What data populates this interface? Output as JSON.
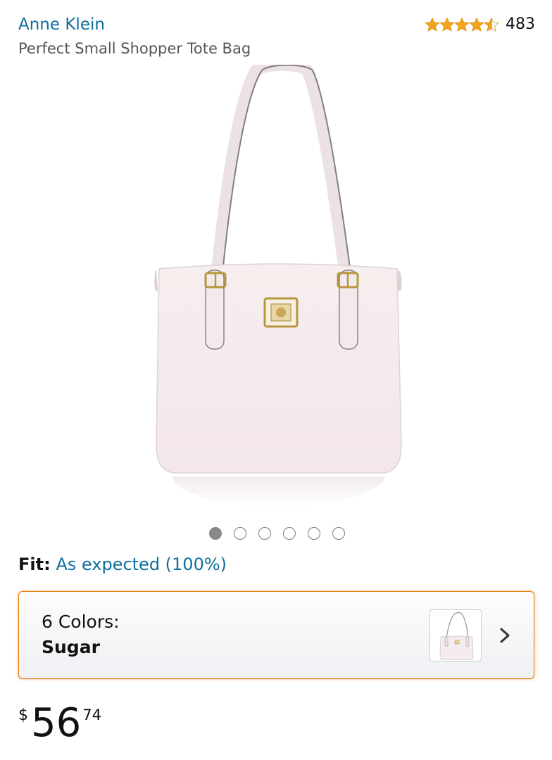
{
  "product": {
    "brand": "Anne Klein",
    "title": "Perfect Small Shopper Tote Bag"
  },
  "rating": {
    "stars": 4.5,
    "count": "483",
    "star_color": "#F4A41C"
  },
  "gallery": {
    "image_icon": "white-tote-bag-photo",
    "image_count": 6,
    "active_index": 0
  },
  "fit": {
    "label": "Fit:",
    "value": "As expected (100%)"
  },
  "variant": {
    "colors_label": "6 Colors:",
    "selected": "Sugar",
    "thumbnail_icon": "tote-bag-thumbnail",
    "chevron_icon": "chevron-right-icon"
  },
  "price": {
    "symbol": "$",
    "whole": "56",
    "fraction": "74"
  },
  "colors": {
    "link": "#0F6F9C",
    "accent_border": "#E77600"
  }
}
